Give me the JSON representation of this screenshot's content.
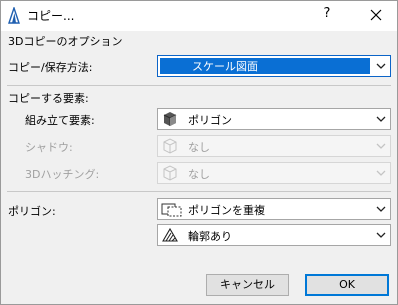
{
  "window": {
    "title": "コピー...",
    "help_label": "?",
    "close_icon": "close-icon",
    "app_icon": "archicad-icon"
  },
  "options_heading": "3Dコピーのオプション",
  "copy_method": {
    "label": "コピー/保存方法:",
    "value": "スケール図面"
  },
  "elements_heading": "コピーする要素:",
  "assembly": {
    "label": "組み立て要素:",
    "value": "ポリゴン",
    "icon": "solid-block-icon"
  },
  "shadow": {
    "label": "シャドウ:",
    "value": "なし",
    "icon": "wireframe-cube-icon"
  },
  "hatching": {
    "label": "3Dハッチング:",
    "value": "なし",
    "icon": "wireframe-cube-icon"
  },
  "polygon": {
    "label": "ポリゴン:",
    "mode_value": "ポリゴンを重複",
    "mode_icon": "overlapping-polygons-icon",
    "outline_value": "輪郭あり",
    "outline_icon": "outline-hatch-icon"
  },
  "buttons": {
    "cancel": "キャンセル",
    "ok": "OK"
  },
  "colors": {
    "selection": "#0a6fd4",
    "default_button_border": "#0078d7"
  }
}
